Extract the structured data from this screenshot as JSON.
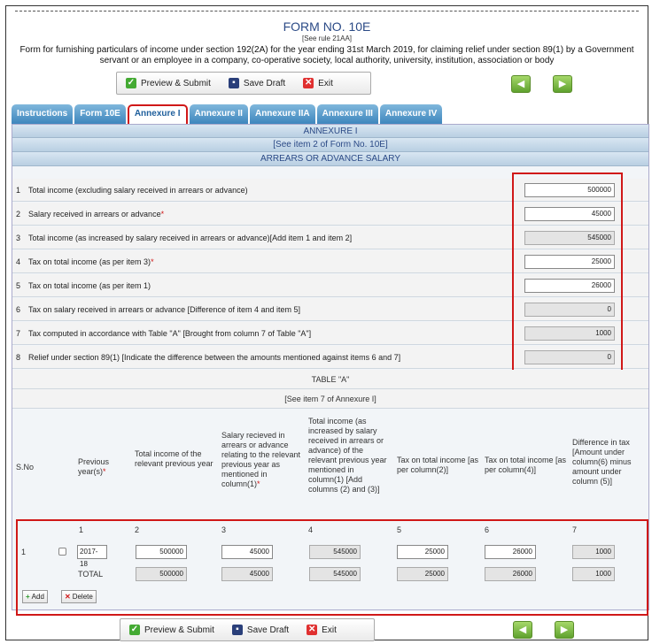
{
  "header": {
    "title": "FORM NO. 10E",
    "rule": "[See rule 21AA]",
    "description": "Form for furnishing particulars of income under section 192(2A) for the year ending 31st March 2019, for claiming relief under section 89(1) by a Government servant or an employee in a company, co-operative society, local authority, university, institution, association or body"
  },
  "toolbar": {
    "preview": "Preview & Submit",
    "save": "Save Draft",
    "exit": "Exit"
  },
  "tabs": [
    "Instructions",
    "Form 10E",
    "Annexure I",
    "Annexure II",
    "Annexure IIA",
    "Annexure III",
    "Annexure IV"
  ],
  "annexure": {
    "title": "ANNEXURE I",
    "see": "[See item 2 of Form No. 10E]",
    "section": "ARREARS OR ADVANCE SALARY"
  },
  "items": [
    {
      "n": "1",
      "label": "Total income (excluding salary received in arrears or advance)",
      "req": "",
      "value": "500000"
    },
    {
      "n": "2",
      "label": "Salary received in arrears or advance",
      "req": "*",
      "value": "45000"
    },
    {
      "n": "3",
      "label": "Total income (as increased by salary received in arrears or advance)[Add item 1 and item 2]",
      "req": "",
      "value": "545000"
    },
    {
      "n": "4",
      "label": "Tax on total income (as per item 3)",
      "req": "*",
      "value": "25000"
    },
    {
      "n": "5",
      "label": "Tax on total income (as per item 1)",
      "req": "",
      "value": "26000"
    },
    {
      "n": "6",
      "label": "Tax on salary received in arrears or advance [Difference of item 4 and item 5]",
      "req": "",
      "value": "0"
    },
    {
      "n": "7",
      "label": "Tax computed in accordance with Table \"A\" [Brought from column 7 of Table \"A\"]",
      "req": "",
      "value": "1000"
    },
    {
      "n": "8",
      "label": "Relief under section 89(1) [Indicate the difference between the amounts mentioned against items 6 and 7]",
      "req": "",
      "value": "0"
    }
  ],
  "tableA": {
    "title": "TABLE \"A\"",
    "see": "[See item 7 of Annexure I]",
    "headers": {
      "sno": "S.No",
      "c1": "Previous year(s)",
      "c1req": "*",
      "c2": "Total income of the relevant previous year",
      "c3": "Salary recieved in arrears or advance relating to the relevant previous year as mentioned in column(1)",
      "c3req": "*",
      "c4": "Total income (as increased by salary received in arrears or advance) of the relevant previous year mentioned in column(1) [Add columns (2) and (3)]",
      "c5": "Tax on total income [as per column(2)]",
      "c6": "Tax on total income [as per column(4)]",
      "c7": "Difference in tax [Amount under column(6) minus amount under column (5)]"
    },
    "colnums": [
      "1",
      "2",
      "3",
      "4",
      "5",
      "6",
      "7"
    ],
    "row": {
      "sno": "1",
      "year": "2017-18",
      "c2": "500000",
      "c3": "45000",
      "c4": "545000",
      "c5": "25000",
      "c6": "26000",
      "c7": "1000"
    },
    "total": {
      "label": "TOTAL",
      "c2": "500000",
      "c3": "45000",
      "c4": "545000",
      "c5": "25000",
      "c6": "26000",
      "c7": "1000"
    },
    "add": "Add",
    "delete": "Delete"
  }
}
